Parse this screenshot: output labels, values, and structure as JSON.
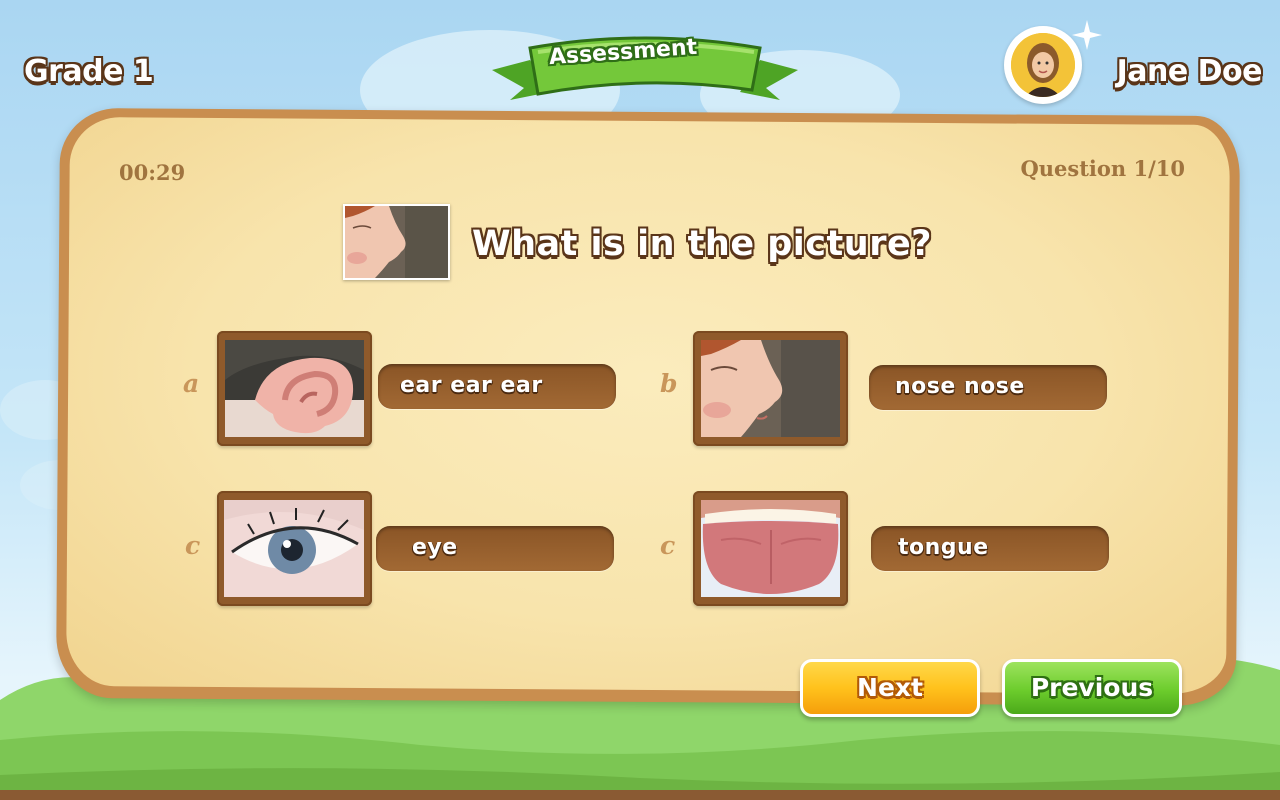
{
  "header": {
    "grade": "Grade 1",
    "title": "Assessment",
    "user_name": "Jane Doe"
  },
  "quiz": {
    "timer": "00:29",
    "progress": "Question 1/10",
    "question": "What is in the picture?",
    "question_image_icon": "nose-photo",
    "options": [
      {
        "letter": "a",
        "label": "ear ear ear",
        "image_icon": "ear-photo"
      },
      {
        "letter": "b",
        "label": "nose nose",
        "image_icon": "nose-photo"
      },
      {
        "letter": "c",
        "label": "eye",
        "image_icon": "eye-photo"
      },
      {
        "letter": "c",
        "label": "tongue",
        "image_icon": "tongue-photo"
      }
    ]
  },
  "buttons": {
    "next": "Next",
    "previous": "Previous"
  },
  "colors": {
    "board": "#f8e4ac",
    "board_border": "#c98e4f",
    "pill": "#9a6230",
    "next_button": "#ffc21c",
    "previous_button": "#6ccc2c",
    "ribbon": "#74c83a"
  }
}
